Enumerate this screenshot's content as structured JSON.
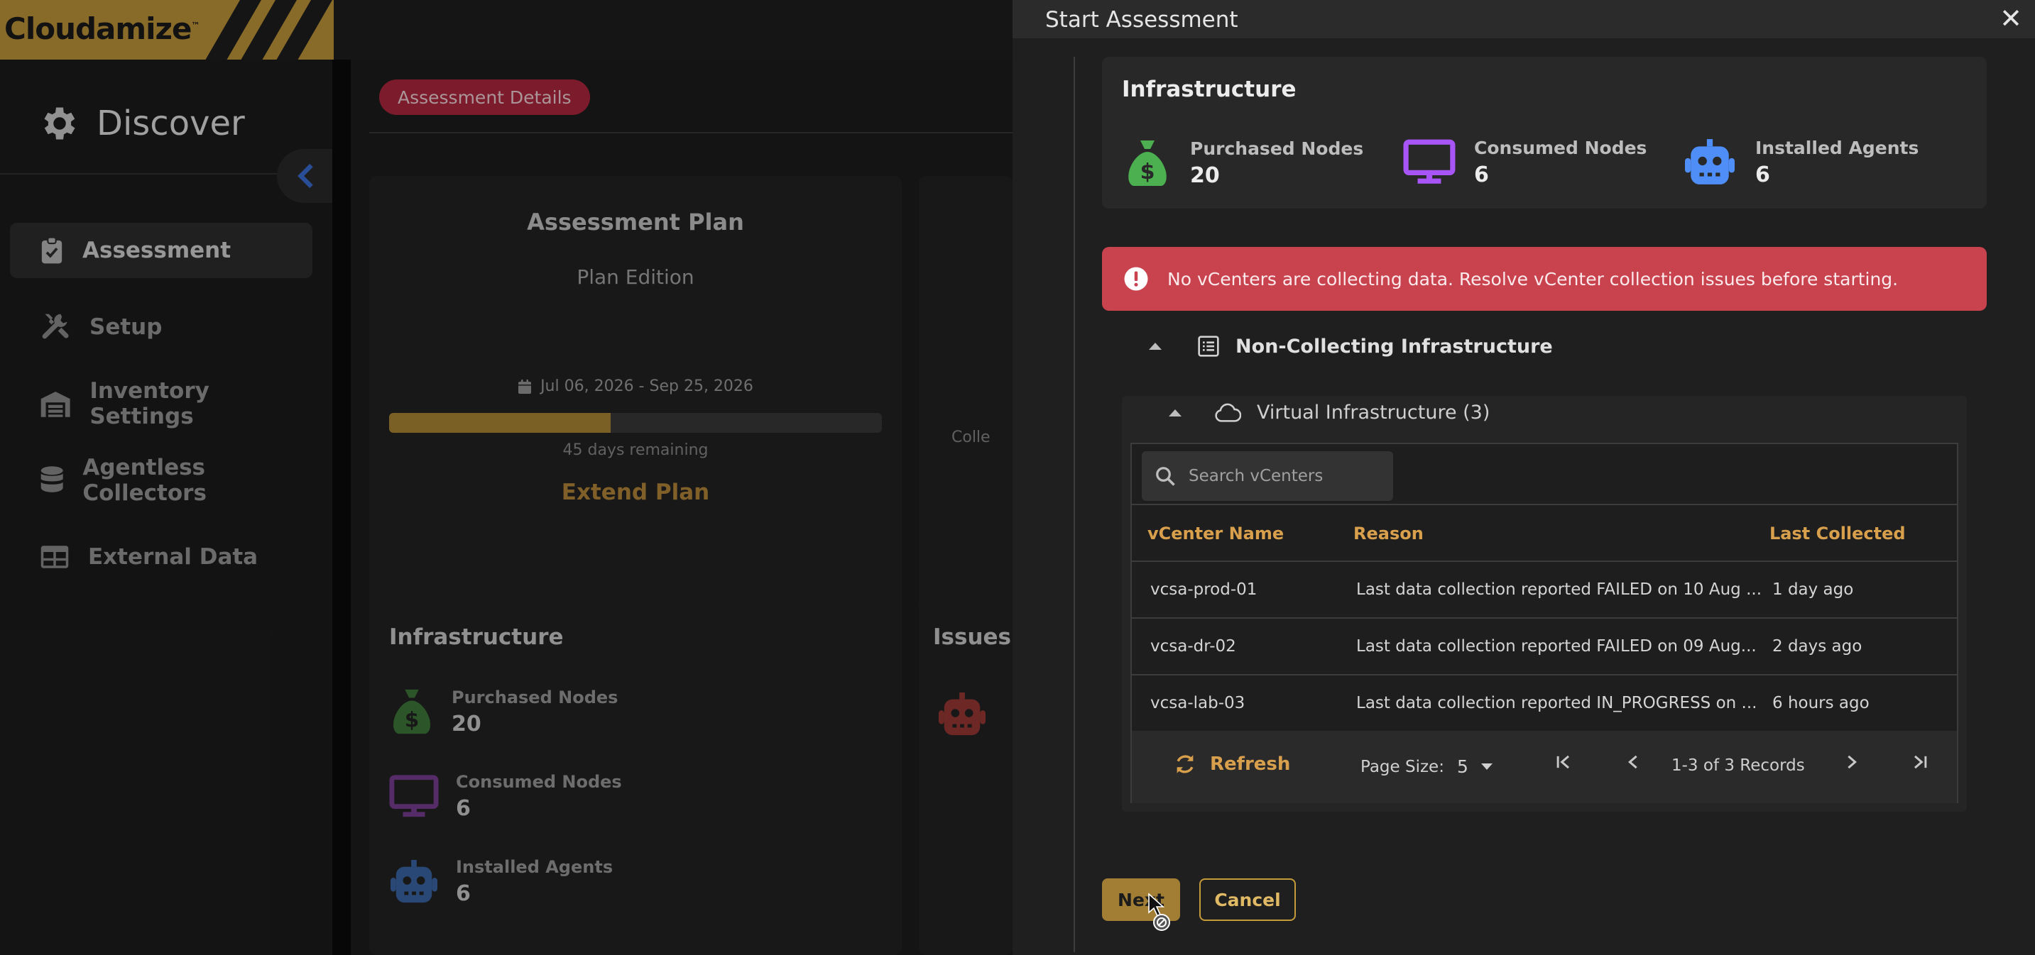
{
  "brand": {
    "logo_text": "Cloudamize",
    "logo_tm": "™"
  },
  "sidebar": {
    "section_title": "Discover",
    "items": [
      {
        "label": "Assessment",
        "icon": "clipboard-check-icon",
        "active": true
      },
      {
        "label": "Setup",
        "icon": "tools-icon",
        "active": false
      },
      {
        "label": "Inventory Settings",
        "icon": "warehouse-icon",
        "active": false
      },
      {
        "label": "Agentless Collectors",
        "icon": "database-icon",
        "active": false
      },
      {
        "label": "External Data",
        "icon": "table-icon",
        "active": false
      }
    ]
  },
  "main": {
    "chip": "Assessment Details",
    "plan": {
      "title": "Assessment Plan",
      "edition": "Plan Edition",
      "date_range": "Jul 06, 2026 - Sep 25, 2026",
      "progress_fraction": 0.45,
      "remaining": "45 days remaining",
      "extend": "Extend Plan"
    },
    "partial_label": "Colle",
    "infrastructure": {
      "title": "Infrastructure",
      "stats": [
        {
          "label": "Purchased Nodes",
          "value": "20"
        },
        {
          "label": "Consumed Nodes",
          "value": "6"
        },
        {
          "label": "Installed Agents",
          "value": "6"
        }
      ]
    },
    "issues_title": "Issues"
  },
  "modal": {
    "title": "Start Assessment",
    "close": "✕",
    "infrastructure": {
      "title": "Infrastructure",
      "stats": [
        {
          "label": "Purchased Nodes",
          "value": "20",
          "color": "#4caf50"
        },
        {
          "label": "Consumed Nodes",
          "value": "6",
          "color": "#a855f7"
        },
        {
          "label": "Installed Agents",
          "value": "6",
          "color": "#4f8ef7"
        }
      ]
    },
    "alert": "No vCenters are collecting data. Resolve vCenter collection issues before starting.",
    "non_collecting_title": "Non-Collecting Infrastructure",
    "virtual_title": "Virtual Infrastructure (3)",
    "search_placeholder": "Search vCenters",
    "table": {
      "columns": [
        "vCenter Name",
        "Reason",
        "Last Collected"
      ],
      "rows": [
        {
          "name": "vcsa-prod-01",
          "reason": "Last data collection reported FAILED on 10 Aug ...",
          "last": "1 day ago"
        },
        {
          "name": "vcsa-dr-02",
          "reason": "Last data collection reported FAILED on 09 Aug...",
          "last": "2 days ago"
        },
        {
          "name": "vcsa-lab-03",
          "reason": "Last data collection reported IN_PROGRESS on ...",
          "last": "6 hours ago"
        }
      ]
    },
    "footer": {
      "refresh": "Refresh",
      "page_size_label": "Page Size:",
      "page_size_value": "5",
      "records": "1-3 of 3 Records"
    },
    "buttons": {
      "next": "Next",
      "cancel": "Cancel"
    }
  },
  "colors": {
    "accent": "#c59a3b",
    "alert": "#c9434f",
    "chip": "#b1283f"
  }
}
